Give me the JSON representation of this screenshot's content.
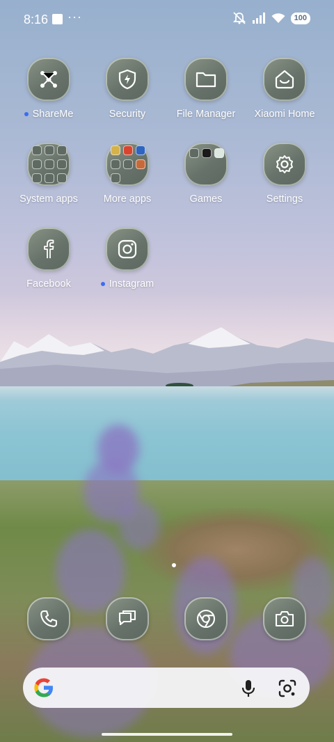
{
  "status_bar": {
    "time": "8:16",
    "overflow": "···",
    "battery": "100",
    "icons": [
      "mute-icon",
      "signal-icon",
      "wifi-icon",
      "battery-icon"
    ]
  },
  "apps": [
    {
      "name": "shareme",
      "label": "ShareMe",
      "icon": "shareme-icon",
      "new": true
    },
    {
      "name": "security",
      "label": "Security",
      "icon": "shield-icon",
      "new": false
    },
    {
      "name": "file-manager",
      "label": "File Manager",
      "icon": "folder-icon",
      "new": false
    },
    {
      "name": "xiaomi-home",
      "label": "Xiaomi Home",
      "icon": "home-icon",
      "new": false
    },
    {
      "name": "system-apps",
      "label": "System apps",
      "icon": "folder-grid-icon",
      "new": false
    },
    {
      "name": "more-apps",
      "label": "More apps",
      "icon": "folder-grid-icon",
      "new": false
    },
    {
      "name": "games",
      "label": "Games",
      "icon": "folder-grid-icon",
      "new": false
    },
    {
      "name": "settings",
      "label": "Settings",
      "icon": "gear-icon",
      "new": false
    },
    {
      "name": "facebook",
      "label": "Facebook",
      "icon": "facebook-icon",
      "new": false
    },
    {
      "name": "instagram",
      "label": "Instagram",
      "icon": "instagram-icon",
      "new": true
    }
  ],
  "dock": [
    "phone-icon",
    "messages-icon",
    "chrome-icon",
    "camera-icon"
  ],
  "search": {
    "icons": [
      "google-icon",
      "mic-icon",
      "lens-icon"
    ]
  },
  "colors": {
    "accent_dot": "#3d6bf4",
    "icon_bg": "#67726a"
  }
}
